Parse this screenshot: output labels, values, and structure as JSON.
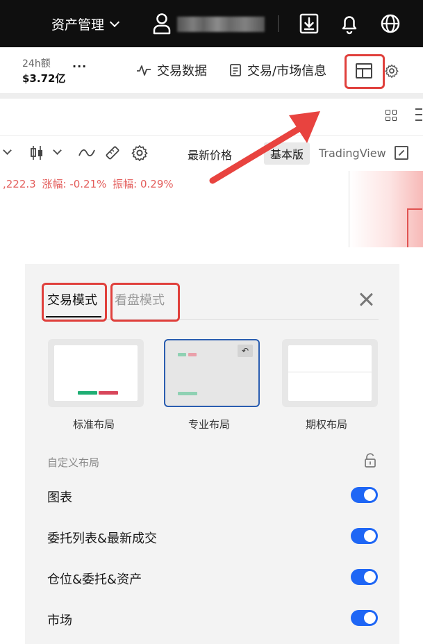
{
  "topbar": {
    "asset_menu_label": "资产管理",
    "icons": [
      "user-icon",
      "download-icon",
      "bell-icon",
      "globe-icon"
    ]
  },
  "ticker": {
    "volume_label": "24h额",
    "volume_value": "$3.72亿",
    "more": "···",
    "links": [
      "交易数据",
      "交易/市场信息"
    ]
  },
  "chart_toolbar": {
    "latest_price": "最新价格",
    "basic": "基本版",
    "tradingview": "TradingView"
  },
  "chart_info": {
    "price": ",222.3",
    "change": "涨幅: -0.21%",
    "amplitude": "振幅: 0.29%"
  },
  "panel": {
    "tabs": [
      {
        "label": "交易模式",
        "active": true
      },
      {
        "label": "看盘模式",
        "active": false
      }
    ],
    "layouts": [
      {
        "label": "标准布局",
        "selected": false
      },
      {
        "label": "专业布局",
        "selected": true
      },
      {
        "label": "期权布局",
        "selected": false
      }
    ],
    "custom_label": "自定义布局",
    "toggles": [
      {
        "label": "图表",
        "on": true
      },
      {
        "label": "委托列表&最新成交",
        "on": true
      },
      {
        "label": "仓位&委托&资产",
        "on": true
      },
      {
        "label": "市场",
        "on": true
      }
    ]
  },
  "colors": {
    "accent_blue": "#1e66f5",
    "highlight_red": "#e0403c",
    "buy_green": "#1fae74",
    "sell_red": "#d8465a"
  }
}
